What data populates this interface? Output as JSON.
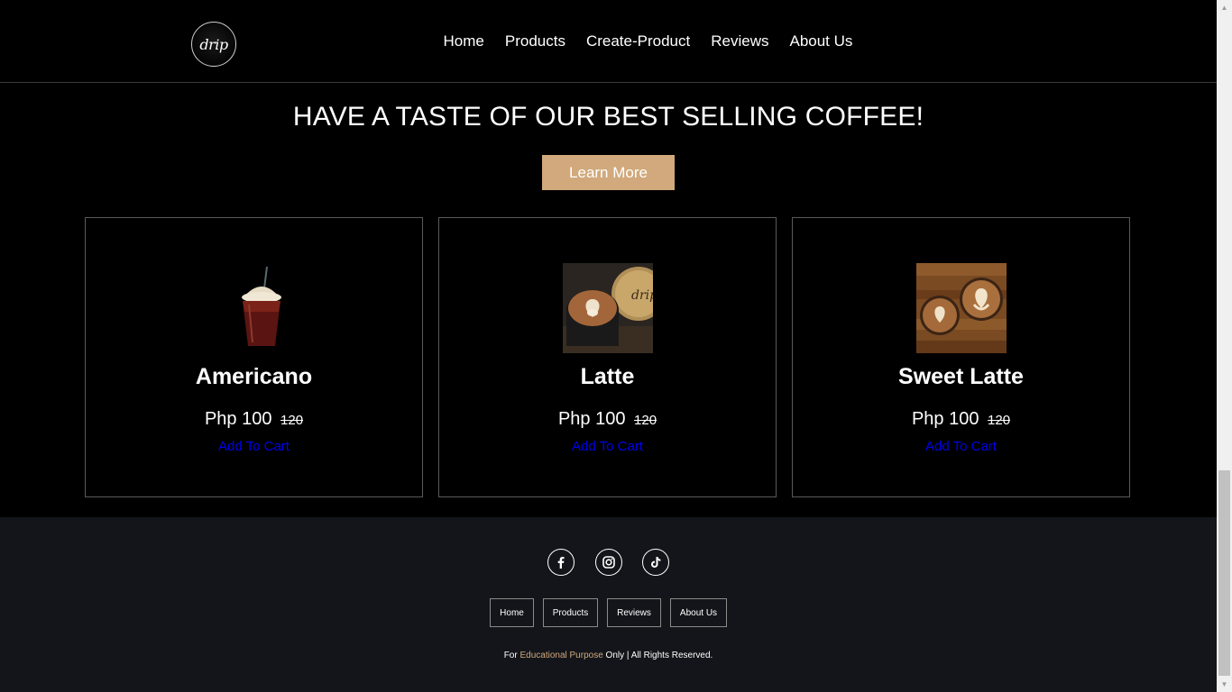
{
  "header": {
    "logo_text": "drip",
    "nav": [
      "Home",
      "Products",
      "Create-Product",
      "Reviews",
      "About Us"
    ]
  },
  "hero": {
    "title": "HAVE A TASTE OF OUR BEST SELLING COFFEE!",
    "button": "Learn More"
  },
  "products": [
    {
      "name": "Americano",
      "price": "Php 100",
      "old_price": "120",
      "cart": "Add To Cart"
    },
    {
      "name": "Latte",
      "price": "Php 100",
      "old_price": "120",
      "cart": "Add To Cart"
    },
    {
      "name": "Sweet Latte",
      "price": "Php 100",
      "old_price": "120",
      "cart": "Add To Cart"
    }
  ],
  "footer": {
    "social": [
      "facebook-icon",
      "instagram-icon",
      "tiktok-icon"
    ],
    "nav": [
      "Home",
      "Products",
      "Reviews",
      "About Us"
    ],
    "copyright": {
      "pre": "For ",
      "highlight": "Educational Purpose",
      "post": " Only | All Rights Reserved."
    }
  },
  "colors": {
    "accent": "#d1a97c",
    "link": "#0000ee",
    "footer_bg": "#13151a"
  }
}
